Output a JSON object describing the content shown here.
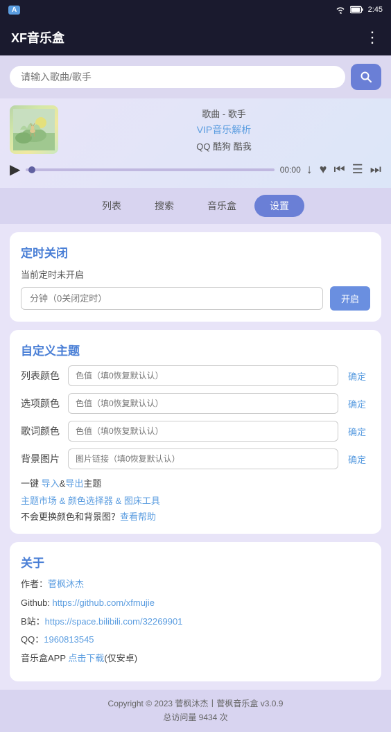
{
  "statusBar": {
    "appIcon": "A",
    "time": "2:45",
    "wifiIcon": "wifi",
    "batteryIcon": "battery",
    "signalIcon": "signal"
  },
  "topBar": {
    "title": "XF音乐盒",
    "moreIcon": "⋮"
  },
  "search": {
    "placeholder": "请输入歌曲/歌手",
    "searchIcon": "🔍"
  },
  "player": {
    "songInfo": "歌曲 - 歌手",
    "vipText": "VIP音乐解析",
    "platforms": "QQ 酷狗 酷我",
    "time": "00:00",
    "playIcon": "▶",
    "downloadIcon": "↓",
    "likeIcon": "♥",
    "prevIcon": "⏮",
    "listIcon": "☰",
    "nextIcon": "⏭"
  },
  "tabs": [
    {
      "id": "list",
      "label": "列表",
      "active": false
    },
    {
      "id": "search",
      "label": "搜索",
      "active": false
    },
    {
      "id": "musicbox",
      "label": "音乐盒",
      "active": false
    },
    {
      "id": "settings",
      "label": "设置",
      "active": true
    }
  ],
  "timer": {
    "title": "定时关闭",
    "status": "当前定时未开启",
    "inputPlaceholder": "分钟（0关闭定时）",
    "enableLabel": "开启"
  },
  "theme": {
    "title": "自定义主题",
    "listColor": {
      "label": "列表颜色",
      "placeholder": "色值（填0恢复默认认）",
      "confirm": "确定"
    },
    "optionColor": {
      "label": "选项颜色",
      "placeholder": "色值（填0恢复默认认）",
      "confirm": "确定"
    },
    "lyricsColor": {
      "label": "歌词颜色",
      "placeholder": "色值（填0恢复默认认）",
      "confirm": "确定"
    },
    "bgImage": {
      "label": "背景图片",
      "placeholder": "图片链接（填0恢复默认认）",
      "confirm": "确定"
    },
    "importExportPrefix": "一键 ",
    "importText": "导入",
    "andText": "&",
    "exportText": "导出",
    "themeSuffix": "主题",
    "marketPrefix": "主题市场 & ",
    "colorPickerText": "颜色选择器",
    "marketAnd": " & ",
    "bedToolText": "图床工具",
    "noChangePrefix": "不会更换颜色和背景图？",
    "helpText": "查看帮助"
  },
  "about": {
    "title": "关于",
    "authorPrefix": "作者：",
    "authorName": "菅枫沐杰",
    "githubPrefix": "Github: ",
    "githubUrl": "https://github.com/xfmujie",
    "bilibiliPrefix": "B站：",
    "bilibiliUrl": "https://space.bilibili.com/32269901",
    "qqPrefix": "QQ：",
    "qqNumber": "1960813545",
    "appPrefix": "音乐盒APP ",
    "downloadText": "点击下载",
    "downloadSuffix": "(仅安卓)"
  },
  "footer": {
    "copyright": "Copyright © 2023 菅枫沐杰丨菅枫音乐盒 v3.0.9",
    "visits": "总访问量 9434 次"
  },
  "colors": {
    "accent": "#5b9de0",
    "activeTab": "#6a7fd6",
    "cardTitle": "#4a7fd6",
    "bgLight": "#e8e4f8",
    "bgMid": "#d8d4f0"
  }
}
